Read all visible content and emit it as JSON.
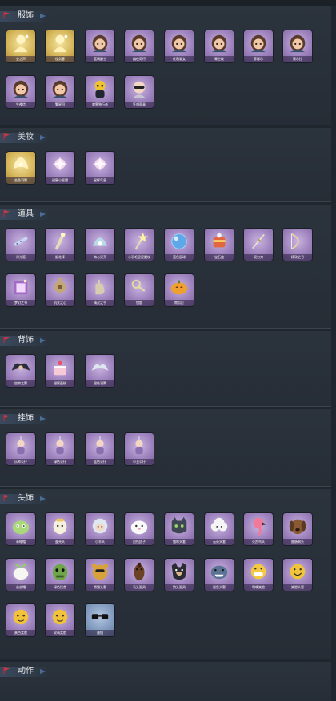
{
  "colors": {
    "background": "#20262e",
    "section": "#2b333d",
    "header_accent": "#3a4a5e",
    "rarity_purple": "#9d82bd",
    "rarity_gold": "#d6b65a",
    "rarity_blue": "#7f98bd"
  },
  "sections": [
    {
      "title": "服饰",
      "items": [
        {
          "label": "金之声",
          "rarity": "gold",
          "icon": "golden-figure-icon"
        },
        {
          "label": "仗剑客",
          "rarity": "gold",
          "icon": "golden-figure-icon"
        },
        {
          "label": "蓝调爵士",
          "rarity": "purple",
          "icon": "character-portrait-icon"
        },
        {
          "label": "幽夜奇行",
          "rarity": "purple",
          "icon": "character-portrait-icon"
        },
        {
          "label": "优雅淑女",
          "rarity": "purple",
          "icon": "character-portrait-icon"
        },
        {
          "label": "青空枝",
          "rarity": "purple",
          "icon": "character-portrait-icon"
        },
        {
          "label": "菲娜尔",
          "rarity": "purple",
          "icon": "character-portrait-icon"
        },
        {
          "label": "蜜尔拉",
          "rarity": "purple",
          "icon": "character-portrait-icon"
        },
        {
          "label": "午夜信",
          "rarity": "purple",
          "icon": "character-portrait-icon"
        },
        {
          "label": "繁星回",
          "rarity": "purple",
          "icon": "character-portrait-icon"
        },
        {
          "label": "寂寥独行者",
          "rarity": "purple",
          "icon": "dark-figure-icon"
        },
        {
          "label": "狂想面具",
          "rarity": "purple",
          "icon": "masked-face-icon"
        }
      ]
    },
    {
      "title": "美妆",
      "items": [
        {
          "label": "金色羽翼",
          "rarity": "gold",
          "icon": "golden-wing-icon"
        },
        {
          "label": "甜蜜小恶魔",
          "rarity": "purple",
          "icon": "sparkle-icon"
        },
        {
          "label": "星辉气息",
          "rarity": "purple",
          "icon": "sparkle-icon"
        }
      ]
    },
    {
      "title": "道具",
      "items": [
        {
          "label": "月光笛",
          "rarity": "purple",
          "icon": "flute-icon"
        },
        {
          "label": "烟花棒",
          "rarity": "purple",
          "icon": "stick-icon"
        },
        {
          "label": "海心贝壳",
          "rarity": "purple",
          "icon": "shell-icon"
        },
        {
          "label": "小羽毛星星魔杖",
          "rarity": "purple",
          "icon": "wand-icon"
        },
        {
          "label": "蓝色星球",
          "rarity": "purple",
          "icon": "blue-orb-icon"
        },
        {
          "label": "宝石盒",
          "rarity": "purple",
          "icon": "orange-box-icon"
        },
        {
          "label": "双刃刀",
          "rarity": "purple",
          "icon": "blade-icon"
        },
        {
          "label": "精致之弓",
          "rarity": "purple",
          "icon": "bow-icon"
        },
        {
          "label": "梦幻之书",
          "rarity": "purple",
          "icon": "book-icon"
        },
        {
          "label": "机关之心",
          "rarity": "purple",
          "icon": "mechanism-icon"
        },
        {
          "label": "精灵之手",
          "rarity": "purple",
          "icon": "hand-icon"
        },
        {
          "label": "钥匙",
          "rarity": "purple",
          "icon": "key-icon"
        },
        {
          "label": "南瓜灯",
          "rarity": "purple",
          "icon": "pumpkin-icon"
        }
      ]
    },
    {
      "title": "背饰",
      "items": [
        {
          "label": "空寂之翼",
          "rarity": "purple",
          "icon": "dark-wing-icon"
        },
        {
          "label": "甜蜜蛋糕",
          "rarity": "purple",
          "icon": "cake-icon"
        },
        {
          "label": "银色羽翼",
          "rarity": "purple",
          "icon": "silver-wing-icon"
        }
      ]
    },
    {
      "title": "挂饰",
      "items": [
        {
          "label": "乐师公仔",
          "rarity": "purple",
          "icon": "doll-icon"
        },
        {
          "label": "绿色公仔",
          "rarity": "purple",
          "icon": "doll-icon"
        },
        {
          "label": "蓝色公仔",
          "rarity": "purple",
          "icon": "doll-icon"
        },
        {
          "label": "小丑公仔",
          "rarity": "purple",
          "icon": "doll-icon"
        }
      ]
    },
    {
      "title": "头饰",
      "items": [
        {
          "label": "青蛙帽",
          "rarity": "purple",
          "icon": "green-hat-icon"
        },
        {
          "label": "蛋壳头",
          "rarity": "purple",
          "icon": "egg-head-icon"
        },
        {
          "label": "小羊头",
          "rarity": "purple",
          "icon": "sheep-head-icon"
        },
        {
          "label": "白色团子",
          "rarity": "purple",
          "icon": "white-blob-icon"
        },
        {
          "label": "猫咪头套",
          "rarity": "purple",
          "icon": "cat-head-icon"
        },
        {
          "label": "云朵头套",
          "rarity": "purple",
          "icon": "cloud-head-icon"
        },
        {
          "label": "火烈鸟头",
          "rarity": "purple",
          "icon": "flamingo-icon"
        },
        {
          "label": "腊肠狗头",
          "rarity": "purple",
          "icon": "dog-head-icon"
        },
        {
          "label": "苗苗帽",
          "rarity": "purple",
          "icon": "sprout-icon"
        },
        {
          "label": "绿色怪兽",
          "rarity": "purple",
          "icon": "green-monster-icon"
        },
        {
          "label": "熊猫头套",
          "rarity": "purple",
          "icon": "bear-head-icon"
        },
        {
          "label": "马头面具",
          "rarity": "purple",
          "icon": "horse-head-icon"
        },
        {
          "label": "狼头面具",
          "rarity": "purple",
          "icon": "wolf-head-icon"
        },
        {
          "label": "鲨鱼头套",
          "rarity": "purple",
          "icon": "shark-head-icon"
        },
        {
          "label": "咧嘴笑脸",
          "rarity": "purple",
          "icon": "grin-face-icon"
        },
        {
          "label": "笑脸头套",
          "rarity": "purple",
          "icon": "smile-face-icon"
        },
        {
          "label": "黄色笑脸",
          "rarity": "purple",
          "icon": "yellow-face-icon"
        },
        {
          "label": "呆萌笑脸",
          "rarity": "purple",
          "icon": "yellow-face-icon"
        },
        {
          "label": "墨镜",
          "rarity": "blue",
          "icon": "sunglasses-icon"
        }
      ]
    },
    {
      "title": "动作",
      "items": []
    }
  ]
}
